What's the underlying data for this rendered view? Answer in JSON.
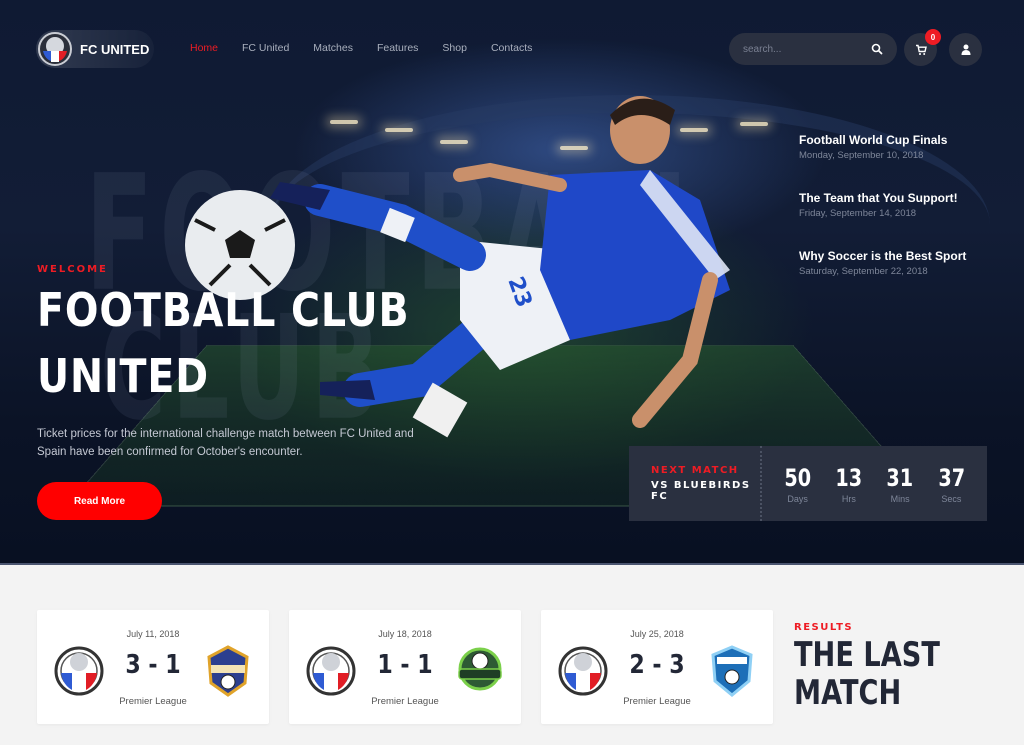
{
  "brand": {
    "name": "FC UNITED"
  },
  "nav": {
    "items": [
      {
        "label": "Home",
        "active": true
      },
      {
        "label": "FC United",
        "active": false
      },
      {
        "label": "Matches",
        "active": false
      },
      {
        "label": "Features",
        "active": false
      },
      {
        "label": "Shop",
        "active": false
      },
      {
        "label": "Contacts",
        "active": false
      }
    ]
  },
  "header": {
    "search_placeholder": "search...",
    "search_icon": "search-icon",
    "cart_icon": "cart-icon",
    "cart_count": "0",
    "user_icon": "user-icon"
  },
  "hero": {
    "background_words": [
      "FOOTBALL",
      "CLUB"
    ],
    "eyebrow": "WELCOME",
    "title_line1": "FOOTBALL CLUB",
    "title_line2": "UNITED",
    "description": "Ticket prices for the international challenge match between FC United and Spain have been confirmed for October's encounter.",
    "cta_label": "Read More",
    "player_number": "23"
  },
  "news": [
    {
      "title": "Football World Cup Finals",
      "date": "Monday, September 10, 2018"
    },
    {
      "title": "The Team that You Support!",
      "date": "Friday, September 14, 2018"
    },
    {
      "title": "Why Soccer is the Best Sport",
      "date": "Saturday, September 22, 2018"
    }
  ],
  "countdown": {
    "label": "NEXT MATCH",
    "opponent": "VS BLUEBIRDS FC",
    "units": [
      {
        "value": "50",
        "label": "Days"
      },
      {
        "value": "13",
        "label": "Hrs"
      },
      {
        "value": "31",
        "label": "Mins"
      },
      {
        "value": "37",
        "label": "Secs"
      }
    ]
  },
  "results": {
    "eyebrow": "RESULTS",
    "title_line1": "THE LAST",
    "title_line2": "MATCH",
    "matches": [
      {
        "date": "July 11, 2018",
        "score": "3 - 1",
        "league": "Premier League",
        "home_badge": "fc-united-badge",
        "away_badge": "soccer-shield-gold-badge"
      },
      {
        "date": "July 18, 2018",
        "score": "1 - 1",
        "league": "Premier League",
        "home_badge": "fc-united-badge",
        "away_badge": "soccer-club-green-badge"
      },
      {
        "date": "July 25, 2018",
        "score": "2 - 3",
        "league": "Premier League",
        "home_badge": "fc-united-badge",
        "away_badge": "football-blue-shield-badge"
      }
    ]
  },
  "colors": {
    "accent": "#ee1c24",
    "hero_bg": "#0f1a33",
    "panel": "#2a3040",
    "text_dark": "#222736"
  }
}
